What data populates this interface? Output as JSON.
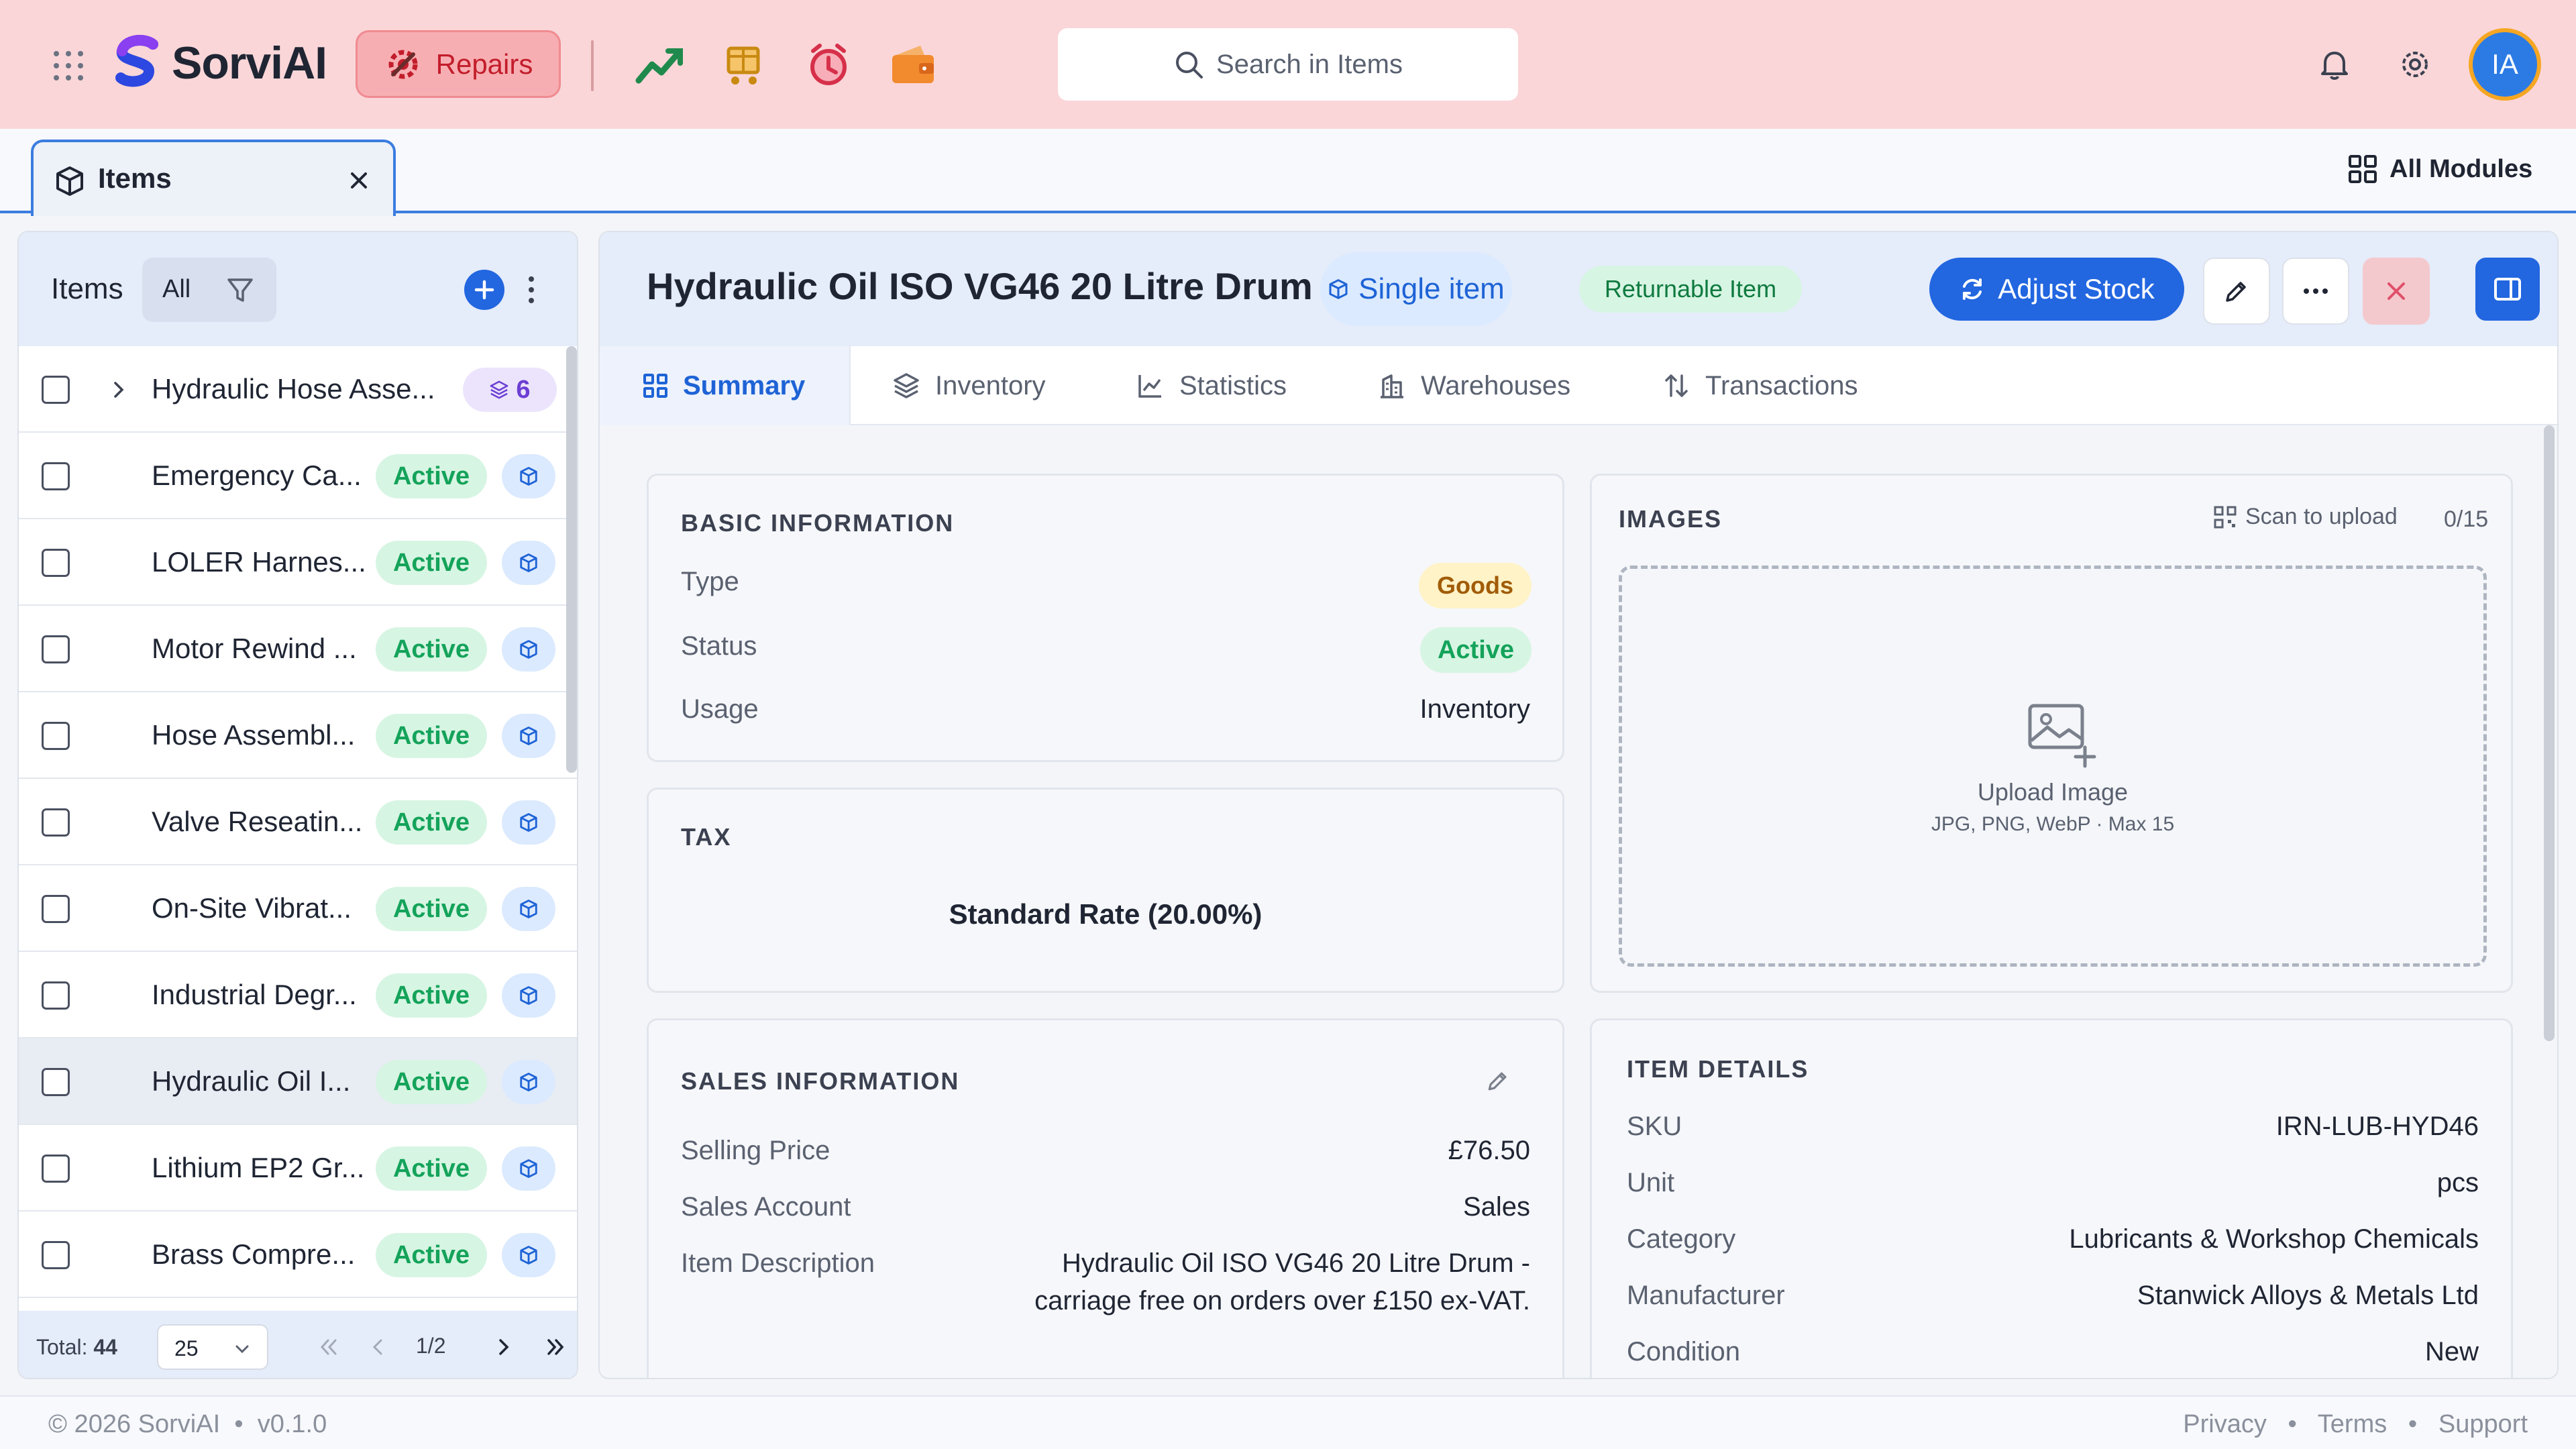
{
  "app": {
    "brand": "SorviAI",
    "module_button": "Repairs",
    "search_placeholder": "Search in Items",
    "user_initials": "IA"
  },
  "tabs": {
    "open_tab": "Items",
    "all_modules": "All Modules"
  },
  "list": {
    "title": "Items",
    "filter_label": "All",
    "rows": [
      {
        "name": "Hydraulic Hose Asse...",
        "status": "",
        "group_count": "6",
        "selected": false
      },
      {
        "name": "Emergency Ca...",
        "status": "Active",
        "selected": false
      },
      {
        "name": "LOLER Harnes...",
        "status": "Active",
        "selected": false
      },
      {
        "name": "Motor Rewind ...",
        "status": "Active",
        "selected": false
      },
      {
        "name": "Hose Assembl...",
        "status": "Active",
        "selected": false
      },
      {
        "name": "Valve Reseatin...",
        "status": "Active",
        "selected": false
      },
      {
        "name": "On-Site Vibrat...",
        "status": "Active",
        "selected": false
      },
      {
        "name": "Industrial Degr...",
        "status": "Active",
        "selected": false
      },
      {
        "name": "Hydraulic Oil I...",
        "status": "Active",
        "selected": true
      },
      {
        "name": "Lithium EP2 Gr...",
        "status": "Active",
        "selected": false
      },
      {
        "name": "Brass Compre...",
        "status": "Active",
        "selected": false
      }
    ],
    "footer": {
      "total_label": "Total:",
      "total_value": "44",
      "page_size": "25",
      "page_indicator": "1/2"
    }
  },
  "detail": {
    "title": "Hydraulic Oil ISO VG46 20 Litre Drum",
    "type_pill": "Single item",
    "returnable_pill": "Returnable Item",
    "adjust_stock": "Adjust Stock",
    "tabs": [
      "Summary",
      "Inventory",
      "Statistics",
      "Warehouses",
      "Transactions"
    ],
    "active_tab": "Summary",
    "basic": {
      "title": "BASIC INFORMATION",
      "type_label": "Type",
      "type_value": "Goods",
      "status_label": "Status",
      "status_value": "Active",
      "usage_label": "Usage",
      "usage_value": "Inventory"
    },
    "tax": {
      "title": "TAX",
      "value": "Standard Rate (20.00%)"
    },
    "sales": {
      "title": "SALES INFORMATION",
      "price_label": "Selling Price",
      "price_value": "£76.50",
      "account_label": "Sales Account",
      "account_value": "Sales",
      "desc_label": "Item Description",
      "desc_line1": "Hydraulic Oil ISO VG46 20 Litre Drum -",
      "desc_line2": "carriage free on orders over £150 ex-VAT."
    },
    "images": {
      "title": "IMAGES",
      "scan_label": "Scan to upload",
      "count": "0/15",
      "upload_label": "Upload Image",
      "upload_hint": "JPG, PNG, WebP · Max 15"
    },
    "item_details": {
      "title": "ITEM DETAILS",
      "sku_label": "SKU",
      "sku_value": "IRN-LUB-HYD46",
      "unit_label": "Unit",
      "unit_value": "pcs",
      "category_label": "Category",
      "category_value": "Lubricants & Workshop Chemicals",
      "manufacturer_label": "Manufacturer",
      "manufacturer_value": "Stanwick Alloys & Metals Ltd",
      "condition_label": "Condition",
      "condition_value": "New"
    }
  },
  "footer": {
    "copyright": "© 2026 SorviAI",
    "version": "v0.1.0",
    "links": [
      "Privacy",
      "Terms",
      "Support"
    ]
  },
  "colors": {
    "topbar": "#fad6d8",
    "accent": "#2266e0",
    "active_green": "#14a35a",
    "repairs_red": "#c21d2b"
  }
}
